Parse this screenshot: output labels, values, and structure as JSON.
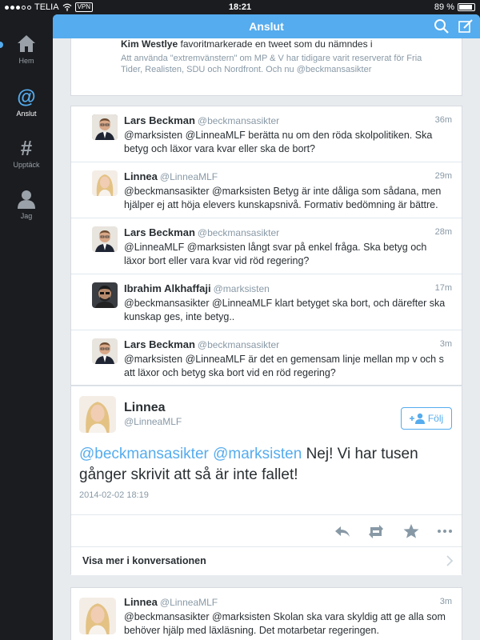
{
  "status_bar": {
    "carrier": "TELIA",
    "vpn": "VPN",
    "time": "18:21",
    "battery": "89 %",
    "battery_level": 0.89
  },
  "sidebar": {
    "items": [
      {
        "label": "Hem",
        "icon": "home-icon"
      },
      {
        "label": "Anslut",
        "icon": "at-icon"
      },
      {
        "label": "Upptäck",
        "icon": "hashtag-icon"
      },
      {
        "label": "Jag",
        "icon": "user-icon"
      }
    ]
  },
  "header": {
    "title": "Anslut",
    "search_icon": "search-icon",
    "compose_icon": "compose-icon"
  },
  "notice": {
    "name": "Kim Westlye",
    "action": "favoritmarkerade en tweet som du nämndes i",
    "quote": "Att använda \"extremvänstern\" om MP & V har tidigare varit reserverat för Fria Tider, Realisten, SDU och Nordfront. Och nu @beckmansasikter"
  },
  "thread": [
    {
      "name": "Lars Beckman",
      "handle": "@beckmansasikter",
      "time": "36m",
      "text": "@marksisten @LinneaMLF berätta nu om den röda skolpolitiken. Ska betyg och läxor vara kvar eller ska de bort?"
    },
    {
      "name": "Linnea",
      "handle": "@LinneaMLF",
      "time": "29m",
      "text": "@beckmansasikter @marksisten Betyg är inte dåliga som sådana, men hjälper ej att höja elevers kunskapsnivå. Formativ bedömning är bättre."
    },
    {
      "name": "Lars Beckman",
      "handle": "@beckmansasikter",
      "time": "28m",
      "text": "@LinneaMLF @marksisten långt svar på enkel fråga. Ska betyg och läxor bort eller vara kvar vid röd regering?"
    },
    {
      "name": "Ibrahim Alkhaffaji",
      "handle": "@marksisten",
      "time": "17m",
      "text": "@beckmansasikter @LinneaMLF klart betyget ska bort, och därefter ska kunskap ges, inte betyg.."
    },
    {
      "name": "Lars Beckman",
      "handle": "@beckmansasikter",
      "time": "3m",
      "text": "@marksisten @LinneaMLF är det en gemensam linje mellan mp v och s att läxor och betyg ska bort vid en röd regering?"
    }
  ],
  "focus": {
    "name": "Linnea",
    "handle": "@LinneaMLF",
    "follow_label": "Följ",
    "mention1": "@beckmansasikter",
    "mention2": "@marksisten",
    "text": "Nej! Vi har tusen gånger skrivit att så är inte fallet!",
    "date": "2014-02-02 18:19",
    "more_label": "Visa mer i konversationen"
  },
  "last": {
    "name": "Linnea",
    "handle": "@LinneaMLF",
    "time": "3m",
    "text": "@beckmansasikter @marksisten Skolan ska vara skyldig att ge alla som behöver hjälp med läxläsning. Det motarbetar regeringen."
  },
  "colors": {
    "accent": "#55acee",
    "sidebar": "#1a1c20",
    "muted": "#8899a6"
  }
}
